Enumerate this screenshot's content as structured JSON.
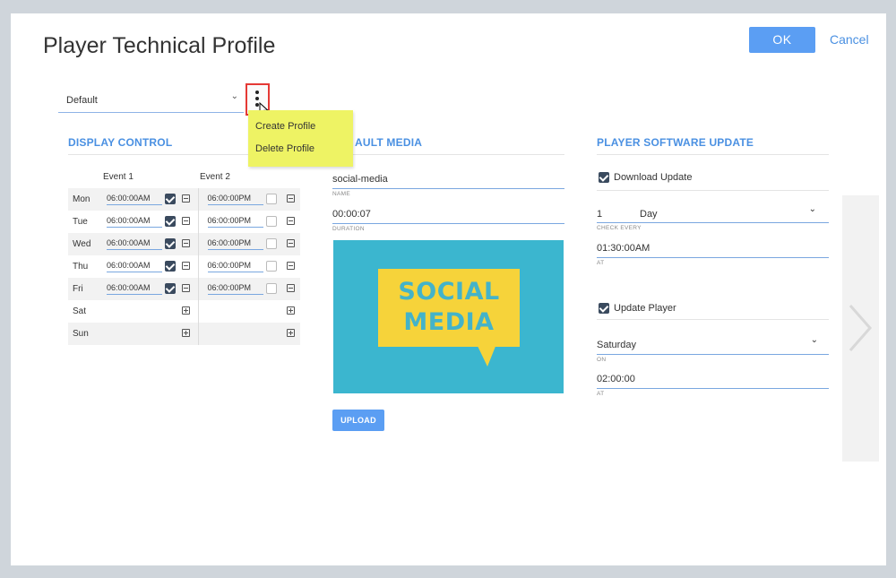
{
  "title": "Player Technical Profile",
  "buttons": {
    "ok": "OK",
    "cancel": "Cancel",
    "upload": "UPLOAD"
  },
  "profile": {
    "selected": "Default",
    "chevron": "⌄",
    "menu_icon": "kebab-icon"
  },
  "menu": {
    "items": [
      "Create Profile",
      "Delete Profile"
    ]
  },
  "display_control": {
    "heading": "DISPLAY CONTROL",
    "event1": "Event 1",
    "event2": "Event 2",
    "rows": [
      {
        "day": "Mon",
        "e1": "06:00:00AM",
        "e1_checked": true,
        "e2": "06:00:00PM",
        "e2_checked": false
      },
      {
        "day": "Tue",
        "e1": "06:00:00AM",
        "e1_checked": true,
        "e2": "06:00:00PM",
        "e2_checked": false
      },
      {
        "day": "Wed",
        "e1": "06:00:00AM",
        "e1_checked": true,
        "e2": "06:00:00PM",
        "e2_checked": false
      },
      {
        "day": "Thu",
        "e1": "06:00:00AM",
        "e1_checked": true,
        "e2": "06:00:00PM",
        "e2_checked": false
      },
      {
        "day": "Fri",
        "e1": "06:00:00AM",
        "e1_checked": true,
        "e2": "06:00:00PM",
        "e2_checked": false
      },
      {
        "day": "Sat",
        "e1": null,
        "e2": null
      },
      {
        "day": "Sun",
        "e1": null,
        "e2": null
      }
    ]
  },
  "default_media": {
    "heading": "AULT MEDIA",
    "name_value": "social-media",
    "name_label": "NAME",
    "duration_value": "00:00:07",
    "duration_label": "DURATION",
    "image_text_1": "SOCIAL",
    "image_text_2": "MEDIA"
  },
  "player_update": {
    "heading": "PLAYER SOFTWARE UPDATE",
    "download_label": "Download Update",
    "check_every_num": "1",
    "check_every_unit": "Day",
    "check_every_label": "CHECK EVERY",
    "at_value": "01:30:00AM",
    "at_label": "AT",
    "update_player_label": "Update Player",
    "on_value": "Saturday",
    "on_label": "ON",
    "at2_value": "02:00:00",
    "at2_label": "AT"
  },
  "colors": {
    "accent": "#4a90e2",
    "button": "#5b9ef3",
    "menu_bg": "#eef364",
    "highlight_border": "#e53935"
  }
}
